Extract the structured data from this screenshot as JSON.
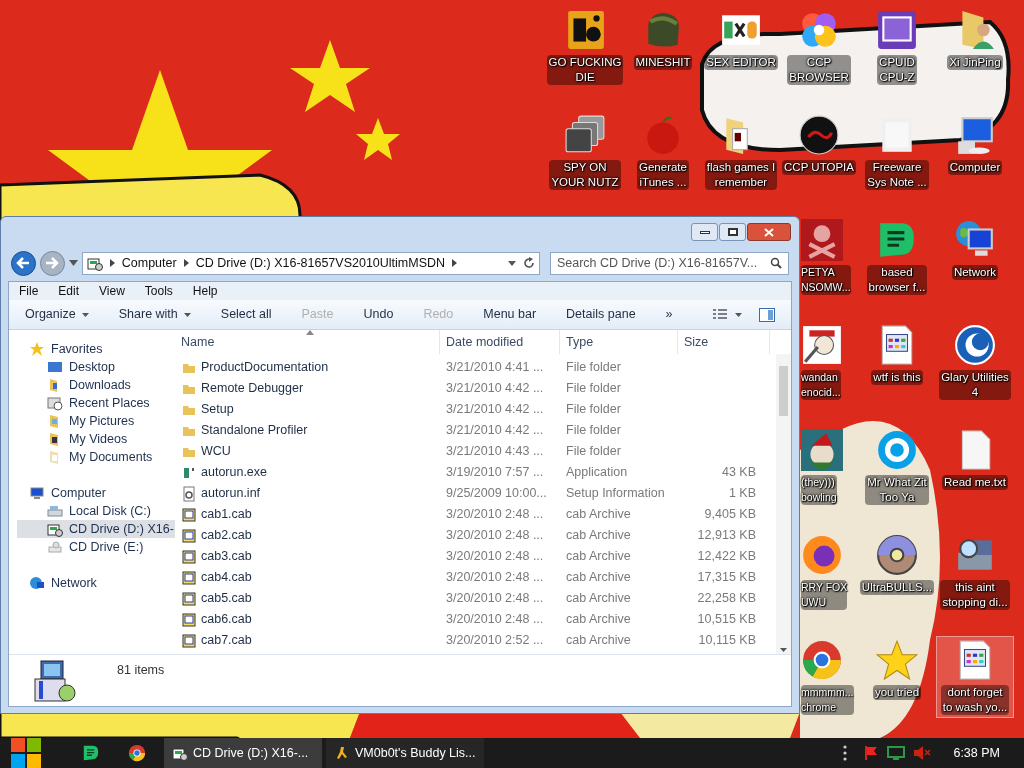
{
  "desktop": {
    "top_rows": [
      [
        {
          "label": "GO FUCKING\nDIE",
          "kind": "letters",
          "selected": false
        },
        {
          "label": "MINESHIT",
          "kind": "block",
          "selected": false
        },
        {
          "label": "SEX EDITOR",
          "kind": "hexed",
          "selected": false
        },
        {
          "label": "CCP\nBROWSER",
          "kind": "swirl",
          "selected": false
        },
        {
          "label": "CPUID\nCPU-Z",
          "kind": "chip",
          "selected": false
        },
        {
          "label": "Xi JinPing",
          "kind": "person",
          "selected": false
        }
      ],
      [
        {
          "label": "SPY ON\nYOUR NUTZ",
          "kind": "windows",
          "selected": false
        },
        {
          "label": "Generate\niTunes ...",
          "kind": "apple",
          "selected": false
        },
        {
          "label": "flash games I\nremember",
          "kind": "folder",
          "selected": false
        },
        {
          "label": "CCP UTOPIA",
          "kind": "disc",
          "selected": false
        },
        {
          "label": "Freeware\nSys Note ...",
          "kind": "blank",
          "selected": false
        },
        {
          "label": "Computer",
          "kind": "monitor",
          "selected": false
        }
      ]
    ],
    "right_rows": [
      [
        {
          "label": "PETYA\nNSOMW...",
          "kind": "skull",
          "selected": false
        },
        {
          "label": "based\nbrowser f...",
          "kind": "speech",
          "selected": false
        },
        {
          "label": "Network",
          "kind": "globe",
          "selected": false
        }
      ],
      [
        {
          "label": "wandan\nenocid...",
          "kind": "meme",
          "selected": false
        },
        {
          "label": "wtf is this",
          "kind": "document",
          "selected": false
        },
        {
          "label": "Glary Utilities\n4",
          "kind": "crescent",
          "selected": false
        }
      ],
      [
        {
          "label": "(they)))\nbowling",
          "kind": "elf",
          "selected": false
        },
        {
          "label": "Mr What Zit\nToo Ya",
          "kind": "skype",
          "selected": false
        },
        {
          "label": "Read me.txt",
          "kind": "paper",
          "selected": false
        }
      ],
      [
        {
          "label": "RRY FOX\nUWU",
          "kind": "firefox",
          "selected": false
        },
        {
          "label": "UltraBULLS...",
          "kind": "cd",
          "selected": false
        },
        {
          "label": "this aint\nstopping di...",
          "kind": "scanner",
          "selected": false
        }
      ],
      [
        {
          "label": "mmmmm...\nchrome",
          "kind": "chrome",
          "selected": false
        },
        {
          "label": "you tried",
          "kind": "star",
          "selected": false
        },
        {
          "label": "dont forget\nto wash yo...",
          "kind": "document",
          "selected": true
        }
      ]
    ]
  },
  "explorer": {
    "breadcrumb": [
      "Computer",
      "CD Drive (D:) X16-81657VS2010UltimMSDN"
    ],
    "search": {
      "placeholder": "Search CD Drive (D:) X16-81657V..."
    },
    "menu": [
      "File",
      "Edit",
      "View",
      "Tools",
      "Help"
    ],
    "toolbar": [
      {
        "label": "Organize",
        "dropdown": true,
        "disabled": false
      },
      {
        "label": "Share with",
        "dropdown": true,
        "disabled": false
      },
      {
        "label": "Select all",
        "dropdown": false,
        "disabled": false
      },
      {
        "label": "Paste",
        "dropdown": false,
        "disabled": true
      },
      {
        "label": "Undo",
        "dropdown": false,
        "disabled": false
      },
      {
        "label": "Redo",
        "dropdown": false,
        "disabled": true
      },
      {
        "label": "Menu bar",
        "dropdown": false,
        "disabled": false
      },
      {
        "label": "Details pane",
        "dropdown": false,
        "disabled": false
      },
      {
        "label": "»",
        "dropdown": false,
        "disabled": false
      }
    ],
    "nav": [
      {
        "label": "Favorites",
        "kind": "star",
        "selected": false,
        "children": [
          {
            "label": "Desktop",
            "kind": "desktop",
            "selected": false
          },
          {
            "label": "Downloads",
            "kind": "downloads",
            "selected": false
          },
          {
            "label": "Recent Places",
            "kind": "recent",
            "selected": false
          },
          {
            "label": "My Pictures",
            "kind": "pictures",
            "selected": false
          },
          {
            "label": "My Videos",
            "kind": "videos",
            "selected": false
          },
          {
            "label": "My Documents",
            "kind": "documents",
            "selected": false
          }
        ]
      },
      {
        "label": "Computer",
        "kind": "computer",
        "selected": false,
        "children": [
          {
            "label": "Local Disk (C:)",
            "kind": "disk",
            "selected": false
          },
          {
            "label": "CD Drive (D:) X16-",
            "kind": "cdrom",
            "selected": true
          },
          {
            "label": "CD Drive (E:)",
            "kind": "cdempty",
            "selected": false
          }
        ]
      },
      {
        "label": "Network",
        "kind": "network",
        "selected": false
      }
    ],
    "columns": [
      "Name",
      "Date modified",
      "Type",
      "Size"
    ],
    "rows": [
      {
        "kind": "folder",
        "name": "ProductDocumentation",
        "date": "3/21/2010 4:41 ...",
        "type": "File folder"
      },
      {
        "kind": "folder",
        "name": "Remote Debugger",
        "date": "3/21/2010 4:42 ...",
        "type": "File folder"
      },
      {
        "kind": "folder",
        "name": "Setup",
        "date": "3/21/2010 4:42 ...",
        "type": "File folder"
      },
      {
        "kind": "folder",
        "name": "Standalone Profiler",
        "date": "3/21/2010 4:42 ...",
        "type": "File folder"
      },
      {
        "kind": "folder",
        "name": "WCU",
        "date": "3/21/2010 4:43 ...",
        "type": "File folder"
      },
      {
        "kind": "exe",
        "name": "autorun.exe",
        "date": "3/19/2010 7:57 ...",
        "type": "Application",
        "size": "43 KB"
      },
      {
        "kind": "inf",
        "name": "autorun.inf",
        "date": "9/25/2009 10:00...",
        "type": "Setup Information",
        "size": "1 KB"
      },
      {
        "kind": "cab",
        "name": "cab1.cab",
        "date": "3/20/2010 2:48 ...",
        "type": "cab Archive",
        "size": "9,405 KB"
      },
      {
        "kind": "cab",
        "name": "cab2.cab",
        "date": "3/20/2010 2:48 ...",
        "type": "cab Archive",
        "size": "12,913 KB"
      },
      {
        "kind": "cab",
        "name": "cab3.cab",
        "date": "3/20/2010 2:48 ...",
        "type": "cab Archive",
        "size": "12,422 KB"
      },
      {
        "kind": "cab",
        "name": "cab4.cab",
        "date": "3/20/2010 2:48 ...",
        "type": "cab Archive",
        "size": "17,315 KB"
      },
      {
        "kind": "cab",
        "name": "cab5.cab",
        "date": "3/20/2010 2:48 ...",
        "type": "cab Archive",
        "size": "22,258 KB"
      },
      {
        "kind": "cab",
        "name": "cab6.cab",
        "date": "3/20/2010 2:48 ...",
        "type": "cab Archive",
        "size": "10,515 KB"
      },
      {
        "kind": "cab",
        "name": "cab7.cab",
        "date": "3/20/2010 2:52 ...",
        "type": "cab Archive",
        "size": "10,115 KB"
      }
    ],
    "status": "81 items"
  },
  "taskbar": {
    "pinned": [
      {
        "kind": "speech"
      },
      {
        "kind": "chrome"
      }
    ],
    "tasks": [
      {
        "label": "CD Drive (D:) X16-...",
        "kind": "cdrom",
        "selected": true
      },
      {
        "label": "VM0b0t's Buddy Lis...",
        "kind": "runner",
        "selected": false
      }
    ],
    "clock": "6:38 PM"
  }
}
